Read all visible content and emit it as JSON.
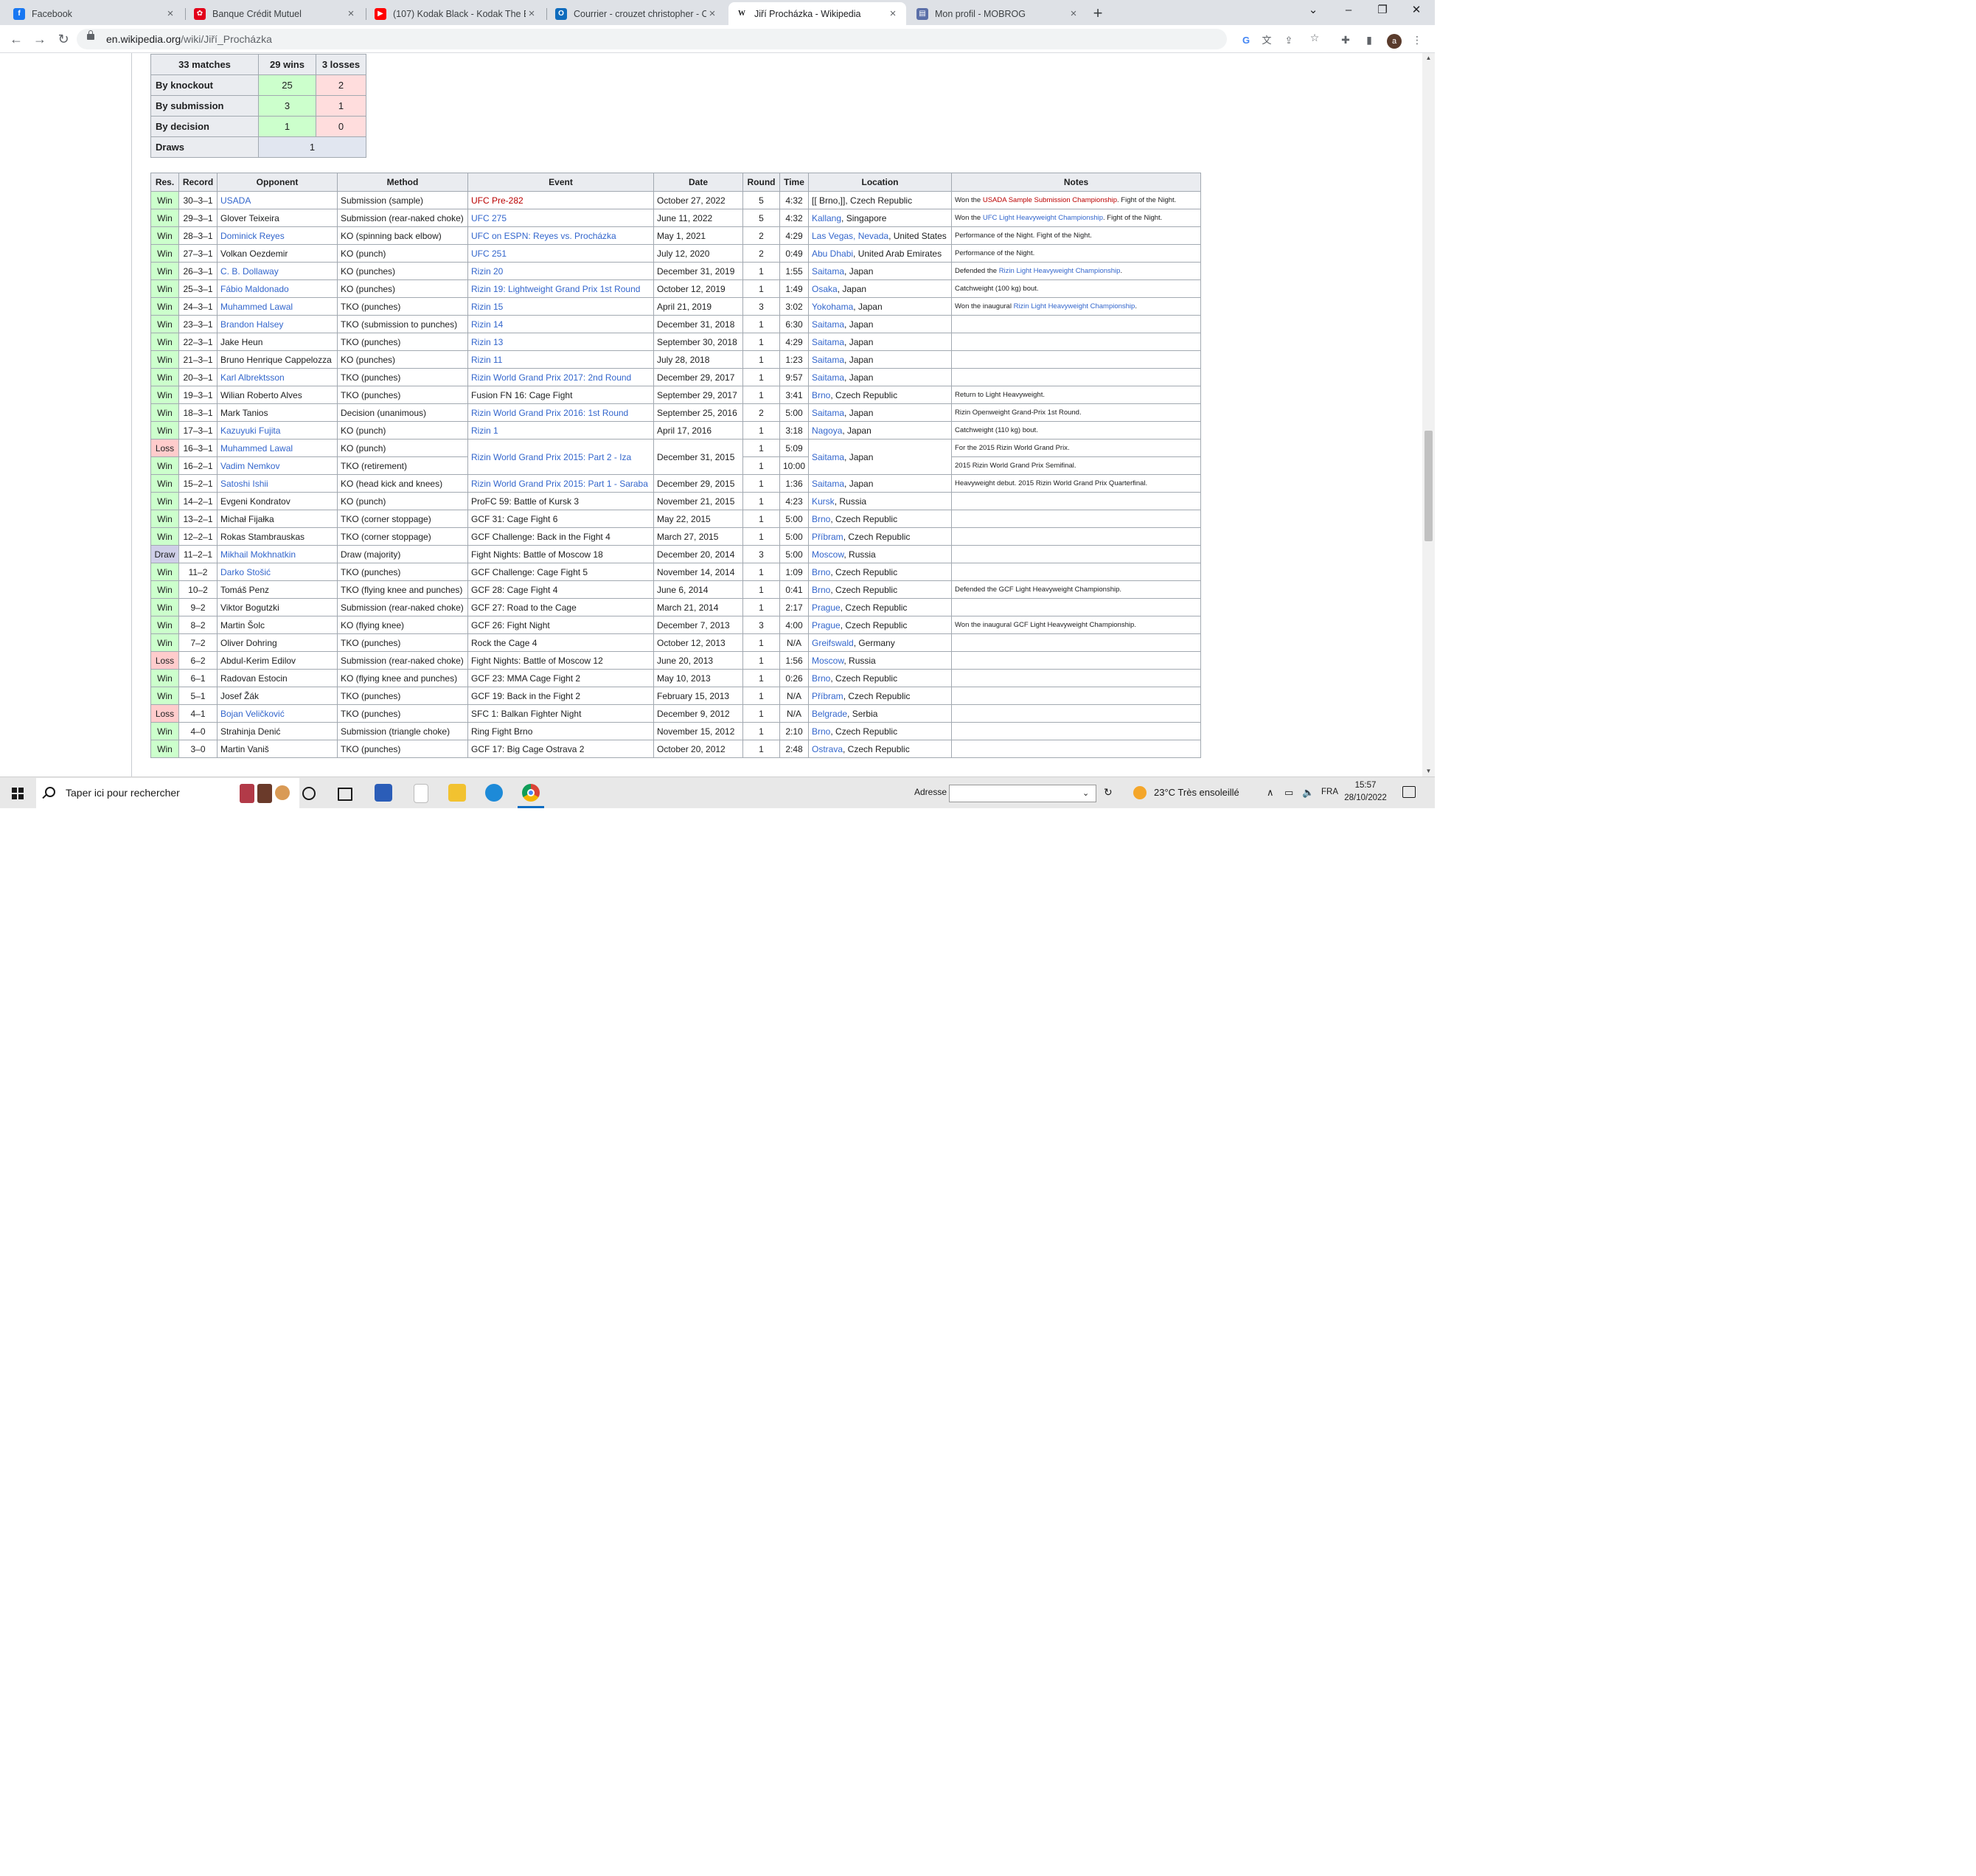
{
  "browser": {
    "tabs": [
      {
        "title": "Facebook",
        "icon": "facebook-icon",
        "color": "#1877f2",
        "glyph": "f"
      },
      {
        "title": "Banque Crédit Mutuel",
        "icon": "credit-mutuel-icon",
        "color": "#e2001a",
        "glyph": "✿"
      },
      {
        "title": "(107) Kodak Black - Kodak The Bo",
        "icon": "youtube-icon",
        "color": "#ff0000",
        "glyph": "▶"
      },
      {
        "title": "Courrier - crouzet christopher - O",
        "icon": "outlook-icon",
        "color": "#0f6cbd",
        "glyph": "O"
      },
      {
        "title": "Jiří Procházka - Wikipedia",
        "icon": "wikipedia-icon",
        "color": "#ffffff",
        "glyph": "W"
      },
      {
        "title": "Mon profil - MOBROG",
        "icon": "mobrog-icon",
        "color": "#5b6fa8",
        "glyph": "▤"
      }
    ],
    "active_tab": 4,
    "new_tab": "+",
    "url_host": "en.wikipedia.org",
    "url_path": "/wiki/Jiří_Procházka"
  },
  "summary": {
    "header": [
      "33 matches",
      "29 wins",
      "3 losses"
    ],
    "rows": [
      {
        "label": "By knockout",
        "wins": "25",
        "losses": "2"
      },
      {
        "label": "By submission",
        "wins": "3",
        "losses": "1"
      },
      {
        "label": "By decision",
        "wins": "1",
        "losses": "0"
      }
    ],
    "draws_label": "Draws",
    "draws_value": "1"
  },
  "record_table": {
    "columns": [
      "Res.",
      "Record",
      "Opponent",
      "Method",
      "Event",
      "Date",
      "Round",
      "Time",
      "Location",
      "Notes"
    ],
    "rows": [
      {
        "res": "Win",
        "record": "30–3–1",
        "opponent": "USADA",
        "opp_link": true,
        "method": "Submission (sample)",
        "event": "UFC Pre-282",
        "ev_link": "red",
        "date": "October 27, 2022",
        "round": "5",
        "time": "4:32",
        "loc_link": "[[ Brno,]]",
        "loc_rest": ", Czech Republic",
        "loc_raw": true,
        "notes": [
          [
            "Won the ",
            ""
          ],
          [
            "USADA Sample Submission Championship",
            "red"
          ],
          [
            ". Fight of the Night.",
            ""
          ]
        ]
      },
      {
        "res": "Win",
        "record": "29–3–1",
        "opponent": "Glover Teixeira",
        "opp_link": false,
        "method": "Submission (rear-naked choke)",
        "event": "UFC 275",
        "ev_link": "blue",
        "date": "June 11, 2022",
        "round": "5",
        "time": "4:32",
        "loc_link": "Kallang",
        "loc_rest": ", Singapore",
        "notes": [
          [
            "Won the ",
            ""
          ],
          [
            "UFC Light Heavyweight Championship",
            "blue"
          ],
          [
            ". Fight of the Night.",
            ""
          ]
        ]
      },
      {
        "res": "Win",
        "record": "28–3–1",
        "opponent": "Dominick Reyes",
        "opp_link": true,
        "method": "KO (spinning back elbow)",
        "event": "UFC on ESPN: Reyes vs. Procházka",
        "ev_link": "blue",
        "date": "May 1, 2021",
        "round": "2",
        "time": "4:29",
        "loc_link": "Las Vegas, Nevada",
        "loc_rest": ", United States",
        "notes": [
          [
            "Performance of the Night. Fight of the Night.",
            ""
          ]
        ]
      },
      {
        "res": "Win",
        "record": "27–3–1",
        "opponent": "Volkan Oezdemir",
        "opp_link": false,
        "method": "KO (punch)",
        "event": "UFC 251",
        "ev_link": "blue",
        "date": "July 12, 2020",
        "round": "2",
        "time": "0:49",
        "loc_link": "Abu Dhabi",
        "loc_rest": ", United Arab Emirates",
        "notes": [
          [
            "Performance of the Night.",
            ""
          ]
        ]
      },
      {
        "res": "Win",
        "record": "26–3–1",
        "opponent": "C. B. Dollaway",
        "opp_link": true,
        "method": "KO (punches)",
        "event": "Rizin 20",
        "ev_link": "blue",
        "date": "December 31, 2019",
        "round": "1",
        "time": "1:55",
        "loc_link": "Saitama",
        "loc_rest": ", Japan",
        "notes": [
          [
            "Defended the ",
            ""
          ],
          [
            "Rizin Light Heavyweight Championship",
            "blue"
          ],
          [
            ".",
            ""
          ]
        ]
      },
      {
        "res": "Win",
        "record": "25–3–1",
        "opponent": "Fábio Maldonado",
        "opp_link": true,
        "method": "KO (punches)",
        "event": "Rizin 19: Lightweight Grand Prix 1st Round",
        "ev_link": "blue",
        "date": "October 12, 2019",
        "round": "1",
        "time": "1:49",
        "loc_link": "Osaka",
        "loc_rest": ", Japan",
        "notes": [
          [
            "Catchweight (100 kg) bout.",
            ""
          ]
        ]
      },
      {
        "res": "Win",
        "record": "24–3–1",
        "opponent": "Muhammed Lawal",
        "opp_link": true,
        "method": "TKO (punches)",
        "event": "Rizin 15",
        "ev_link": "blue",
        "date": "April 21, 2019",
        "round": "3",
        "time": "3:02",
        "loc_link": "Yokohama",
        "loc_rest": ", Japan",
        "notes": [
          [
            "Won the inaugural ",
            ""
          ],
          [
            "Rizin Light Heavyweight Championship",
            "blue"
          ],
          [
            ".",
            ""
          ]
        ]
      },
      {
        "res": "Win",
        "record": "23–3–1",
        "opponent": "Brandon Halsey",
        "opp_link": true,
        "method": "TKO (submission to punches)",
        "event": "Rizin 14",
        "ev_link": "blue",
        "date": "December 31, 2018",
        "round": "1",
        "time": "6:30",
        "loc_link": "Saitama",
        "loc_rest": ", Japan",
        "notes": []
      },
      {
        "res": "Win",
        "record": "22–3–1",
        "opponent": "Jake Heun",
        "opp_link": false,
        "method": "TKO (punches)",
        "event": "Rizin 13",
        "ev_link": "blue",
        "date": "September 30, 2018",
        "round": "1",
        "time": "4:29",
        "loc_link": "Saitama",
        "loc_rest": ", Japan",
        "notes": []
      },
      {
        "res": "Win",
        "record": "21–3–1",
        "opponent": "Bruno Henrique Cappelozza",
        "opp_link": false,
        "method": "KO (punches)",
        "event": "Rizin 11",
        "ev_link": "blue",
        "date": "July 28, 2018",
        "round": "1",
        "time": "1:23",
        "loc_link": "Saitama",
        "loc_rest": ", Japan",
        "notes": []
      },
      {
        "res": "Win",
        "record": "20–3–1",
        "opponent": "Karl Albrektsson",
        "opp_link": true,
        "method": "TKO (punches)",
        "event": "Rizin World Grand Prix 2017: 2nd Round",
        "ev_link": "blue",
        "date": "December 29, 2017",
        "round": "1",
        "time": "9:57",
        "loc_link": "Saitama",
        "loc_rest": ", Japan",
        "notes": []
      },
      {
        "res": "Win",
        "record": "19–3–1",
        "opponent": "Wilian Roberto Alves",
        "opp_link": false,
        "method": "TKO (punches)",
        "event": "Fusion FN 16: Cage Fight",
        "ev_link": "",
        "date": "September 29, 2017",
        "round": "1",
        "time": "3:41",
        "loc_link": "Brno",
        "loc_rest": ", Czech Republic",
        "notes": [
          [
            "Return to Light Heavyweight.",
            ""
          ]
        ]
      },
      {
        "res": "Win",
        "record": "18–3–1",
        "opponent": "Mark Tanios",
        "opp_link": false,
        "method": "Decision (unanimous)",
        "event": "Rizin World Grand Prix 2016: 1st Round",
        "ev_link": "blue",
        "date": "September 25, 2016",
        "round": "2",
        "time": "5:00",
        "loc_link": "Saitama",
        "loc_rest": ", Japan",
        "notes": [
          [
            "Rizin Openweight Grand-Prix 1st Round.",
            ""
          ]
        ]
      },
      {
        "res": "Win",
        "record": "17–3–1",
        "opponent": "Kazuyuki Fujita",
        "opp_link": true,
        "method": "KO (punch)",
        "event": "Rizin 1",
        "ev_link": "blue",
        "date": "April 17, 2016",
        "round": "1",
        "time": "3:18",
        "loc_link": "Nagoya",
        "loc_rest": ", Japan",
        "notes": [
          [
            "Catchweight (110 kg) bout.",
            ""
          ]
        ]
      },
      {
        "res": "Loss",
        "record": "16–3–1",
        "opponent": "Muhammed Lawal",
        "opp_link": true,
        "method": "KO (punch)",
        "event": "Rizin World Grand Prix 2015: Part 2 - Iza",
        "ev_link": "blue",
        "ev_span": 2,
        "date": "December 31, 2015",
        "date_span": 2,
        "round": "1",
        "time": "5:09",
        "loc_link": "Saitama",
        "loc_rest": ", Japan",
        "loc_span": 2,
        "notes": [
          [
            "For the 2015 Rizin World Grand Prix.",
            ""
          ]
        ]
      },
      {
        "res": "Win",
        "record": "16–2–1",
        "opponent": "Vadim Nemkov",
        "opp_link": true,
        "method": "TKO (retirement)",
        "covered": true,
        "round": "1",
        "time": "10:00",
        "notes": [
          [
            "2015 Rizin World Grand Prix Semifinal.",
            ""
          ]
        ]
      },
      {
        "res": "Win",
        "record": "15–2–1",
        "opponent": "Satoshi Ishii",
        "opp_link": true,
        "method": "KO (head kick and knees)",
        "event": "Rizin World Grand Prix 2015: Part 1 - Saraba",
        "ev_link": "blue",
        "date": "December 29, 2015",
        "round": "1",
        "time": "1:36",
        "loc_link": "Saitama",
        "loc_rest": ", Japan",
        "notes": [
          [
            "Heavyweight debut. 2015 Rizin World Grand Prix Quarterfinal.",
            ""
          ]
        ]
      },
      {
        "res": "Win",
        "record": "14–2–1",
        "opponent": "Evgeni Kondratov",
        "opp_link": false,
        "method": "KO (punch)",
        "event": "ProFC 59: Battle of Kursk 3",
        "ev_link": "",
        "date": "November 21, 2015",
        "round": "1",
        "time": "4:23",
        "loc_link": "Kursk",
        "loc_rest": ", Russia",
        "notes": []
      },
      {
        "res": "Win",
        "record": "13–2–1",
        "opponent": "Michał Fijałka",
        "opp_link": false,
        "method": "TKO (corner stoppage)",
        "event": "GCF 31: Cage Fight 6",
        "ev_link": "",
        "date": "May 22, 2015",
        "round": "1",
        "time": "5:00",
        "loc_link": "Brno",
        "loc_rest": ", Czech Republic",
        "notes": []
      },
      {
        "res": "Win",
        "record": "12–2–1",
        "opponent": "Rokas Stambrauskas",
        "opp_link": false,
        "method": "TKO (corner stoppage)",
        "event": "GCF Challenge: Back in the Fight 4",
        "ev_link": "",
        "date": "March 27, 2015",
        "round": "1",
        "time": "5:00",
        "loc_link": "Příbram",
        "loc_rest": ", Czech Republic",
        "notes": []
      },
      {
        "res": "Draw",
        "record": "11–2–1",
        "opponent": "Mikhail Mokhnatkin",
        "opp_link": true,
        "method": "Draw (majority)",
        "event": "Fight Nights: Battle of Moscow 18",
        "ev_link": "",
        "date": "December 20, 2014",
        "round": "3",
        "time": "5:00",
        "loc_link": "Moscow",
        "loc_rest": ", Russia",
        "notes": []
      },
      {
        "res": "Win",
        "record": "11–2",
        "opponent": "Darko Stošić",
        "opp_link": true,
        "method": "TKO (punches)",
        "event": "GCF Challenge: Cage Fight 5",
        "ev_link": "",
        "date": "November 14, 2014",
        "round": "1",
        "time": "1:09",
        "loc_link": "Brno",
        "loc_rest": ", Czech Republic",
        "notes": []
      },
      {
        "res": "Win",
        "record": "10–2",
        "opponent": "Tomáš Penz",
        "opp_link": false,
        "method": "TKO (flying knee and punches)",
        "event": "GCF 28: Cage Fight 4",
        "ev_link": "",
        "date": "June 6, 2014",
        "round": "1",
        "time": "0:41",
        "loc_link": "Brno",
        "loc_rest": ", Czech Republic",
        "notes": [
          [
            "Defended the GCF Light Heavyweight Championship.",
            ""
          ]
        ]
      },
      {
        "res": "Win",
        "record": "9–2",
        "opponent": "Viktor Bogutzki",
        "opp_link": false,
        "method": "Submission (rear-naked choke)",
        "event": "GCF 27: Road to the Cage",
        "ev_link": "",
        "date": "March 21, 2014",
        "round": "1",
        "time": "2:17",
        "loc_link": "Prague",
        "loc_rest": ", Czech Republic",
        "notes": []
      },
      {
        "res": "Win",
        "record": "8–2",
        "opponent": "Martin Šolc",
        "opp_link": false,
        "method": "KO (flying knee)",
        "event": "GCF 26: Fight Night",
        "ev_link": "",
        "date": "December 7, 2013",
        "round": "3",
        "time": "4:00",
        "loc_link": "Prague",
        "loc_rest": ", Czech Republic",
        "notes": [
          [
            "Won the inaugural GCF Light Heavyweight Championship.",
            ""
          ]
        ]
      },
      {
        "res": "Win",
        "record": "7–2",
        "opponent": "Oliver Dohring",
        "opp_link": false,
        "method": "TKO (punches)",
        "event": "Rock the Cage 4",
        "ev_link": "",
        "date": "October 12, 2013",
        "round": "1",
        "time": "N/A",
        "loc_link": "Greifswald",
        "loc_rest": ", Germany",
        "notes": []
      },
      {
        "res": "Loss",
        "record": "6–2",
        "opponent": "Abdul-Kerim Edilov",
        "opp_link": false,
        "method": "Submission (rear-naked choke)",
        "event": "Fight Nights: Battle of Moscow 12",
        "ev_link": "",
        "date": "June 20, 2013",
        "round": "1",
        "time": "1:56",
        "loc_link": "Moscow",
        "loc_rest": ", Russia",
        "notes": []
      },
      {
        "res": "Win",
        "record": "6–1",
        "opponent": "Radovan Estocin",
        "opp_link": false,
        "method": "KO (flying knee and punches)",
        "event": "GCF 23: MMA Cage Fight 2",
        "ev_link": "",
        "date": "May 10, 2013",
        "round": "1",
        "time": "0:26",
        "loc_link": "Brno",
        "loc_rest": ", Czech Republic",
        "notes": []
      },
      {
        "res": "Win",
        "record": "5–1",
        "opponent": "Josef Žák",
        "opp_link": false,
        "method": "TKO (punches)",
        "event": "GCF 19: Back in the Fight 2",
        "ev_link": "",
        "date": "February 15, 2013",
        "round": "1",
        "time": "N/A",
        "loc_link": "Příbram",
        "loc_rest": ", Czech Republic",
        "notes": []
      },
      {
        "res": "Loss",
        "record": "4–1",
        "opponent": "Bojan Veličković",
        "opp_link": true,
        "method": "TKO (punches)",
        "event": "SFC 1: Balkan Fighter Night",
        "ev_link": "",
        "date": "December 9, 2012",
        "round": "1",
        "time": "N/A",
        "loc_link": "Belgrade",
        "loc_rest": ", Serbia",
        "notes": []
      },
      {
        "res": "Win",
        "record": "4–0",
        "opponent": "Strahinja Denić",
        "opp_link": false,
        "method": "Submission (triangle choke)",
        "event": "Ring Fight Brno",
        "ev_link": "",
        "date": "November 15, 2012",
        "round": "1",
        "time": "2:10",
        "loc_link": "Brno",
        "loc_rest": ", Czech Republic",
        "notes": []
      },
      {
        "res": "Win",
        "record": "3–0",
        "opponent": "Martin Vaniš",
        "opp_link": false,
        "method": "TKO (punches)",
        "event": "GCF 17: Big Cage Ostrava 2",
        "ev_link": "",
        "date": "October 20, 2012",
        "round": "1",
        "time": "2:48",
        "loc_link": "Ostrava",
        "loc_rest": ", Czech Republic",
        "notes": []
      }
    ]
  },
  "taskbar": {
    "search_placeholder": "Taper ici pour rechercher",
    "address_label": "Adresse",
    "weather": "23°C  Très ensoleillé",
    "language": "FRA",
    "time": "15:57",
    "date": "28/10/2022"
  }
}
